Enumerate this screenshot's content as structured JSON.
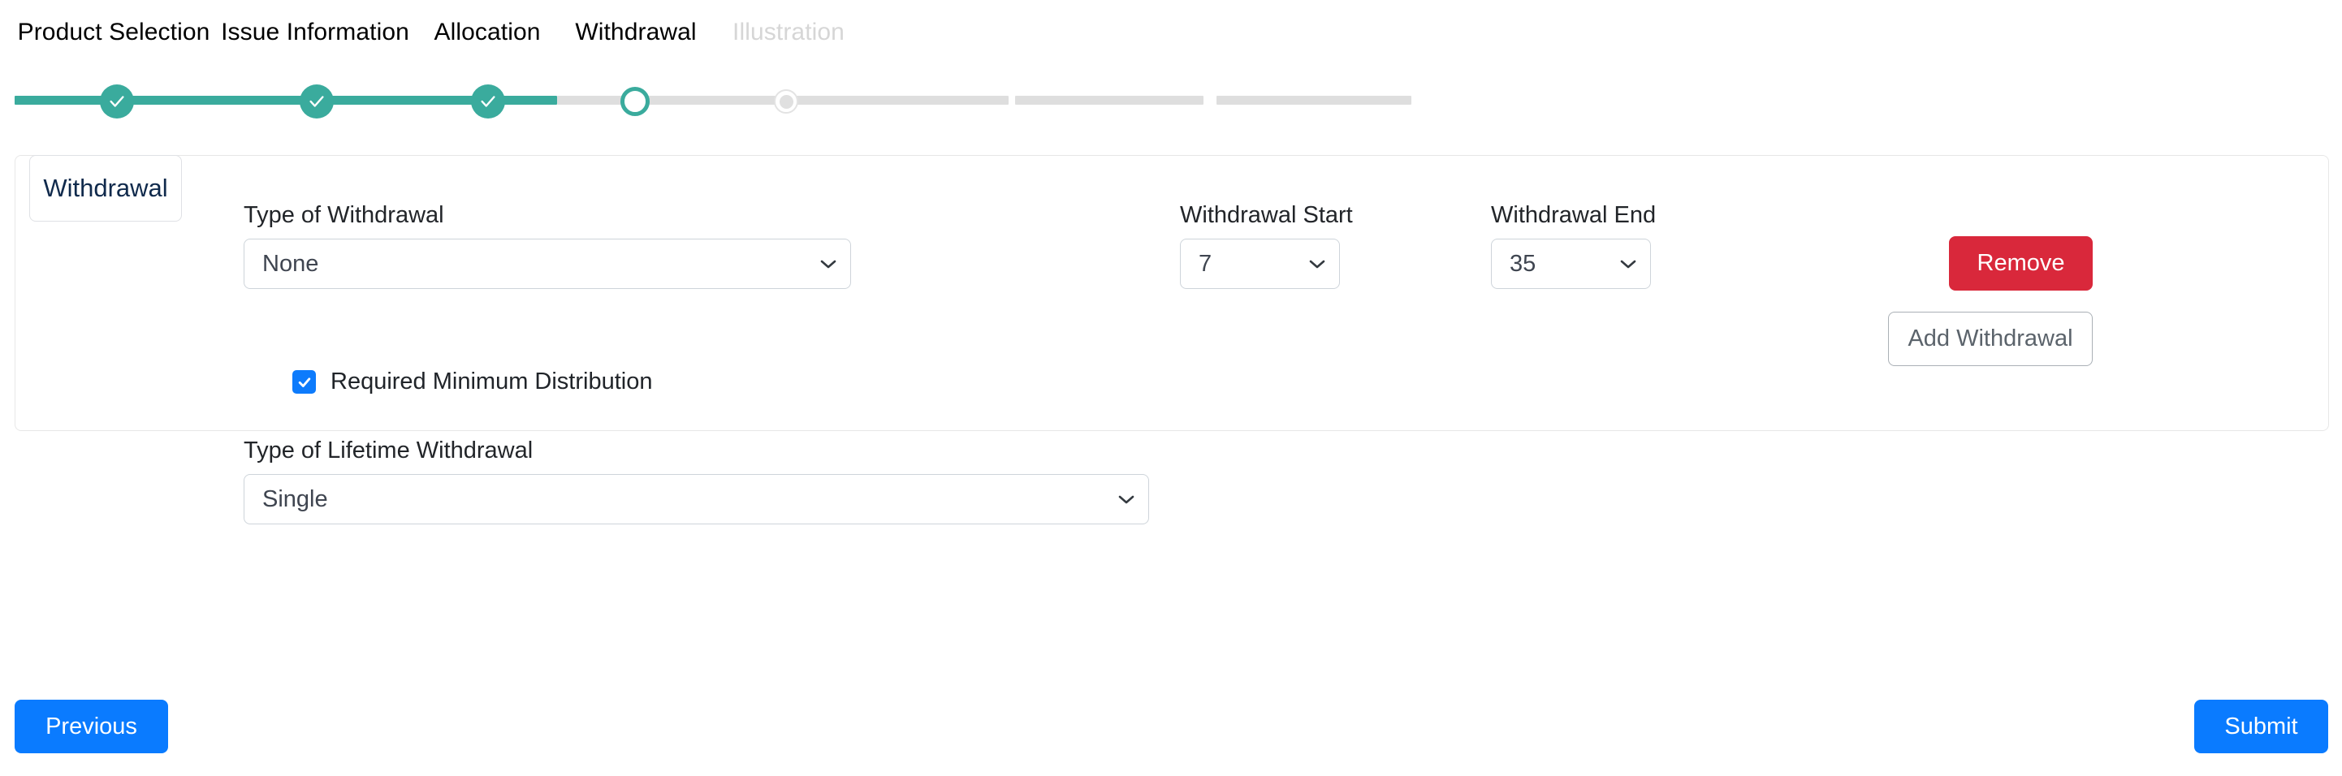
{
  "stepper": {
    "steps": [
      {
        "label": "Product Selection",
        "state": "done"
      },
      {
        "label": "Issue Information",
        "state": "done"
      },
      {
        "label": "Allocation",
        "state": "done"
      },
      {
        "label": "Withdrawal",
        "state": "current"
      },
      {
        "label": "Illustration",
        "state": "pending"
      }
    ],
    "colors": {
      "done": "#3aab9d",
      "track_todo": "#dedede",
      "pending": "#e0e0e0",
      "muted_text": "#d6d6d6"
    }
  },
  "tab": {
    "label": "Withdrawal"
  },
  "form": {
    "type_of_withdrawal": {
      "label": "Type of Withdrawal",
      "value": "None"
    },
    "required_minimum_distribution": {
      "label": "Required Minimum Distribution",
      "checked": true,
      "color": "#0d7bfc"
    },
    "type_of_lifetime_withdrawal": {
      "label": "Type of Lifetime Withdrawal",
      "value": "Single"
    },
    "withdrawal_start": {
      "label": "Withdrawal Start",
      "value": "7"
    },
    "withdrawal_end": {
      "label": "Withdrawal End",
      "value": "35"
    },
    "remove_button": {
      "label": "Remove",
      "color": "#d9283b"
    },
    "add_withdrawal_button": {
      "label": "Add Withdrawal"
    }
  },
  "footer": {
    "previous_label": "Previous",
    "submit_label": "Submit",
    "primary_color": "#0a7bff"
  }
}
